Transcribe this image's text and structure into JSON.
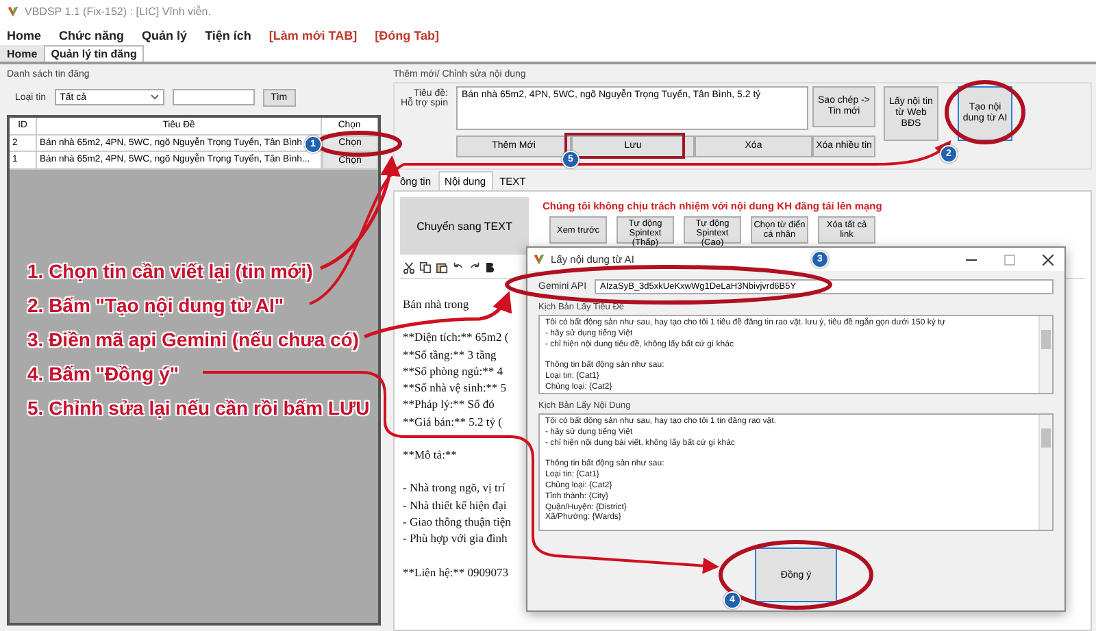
{
  "window": {
    "title": "VBDSP 1.1 (Fix-152) : [LIC] Vĩnh viễn."
  },
  "menu": [
    {
      "label": "Home",
      "kind": "menu"
    },
    {
      "label": "Chức năng",
      "kind": "menu"
    },
    {
      "label": "Quản lý",
      "kind": "menu"
    },
    {
      "label": "Tiện ích",
      "kind": "menu"
    },
    {
      "label": "[Làm mới TAB]",
      "kind": "action"
    },
    {
      "label": "[Đóng Tab]",
      "kind": "action"
    }
  ],
  "tabs": [
    {
      "label": "Home",
      "selected": false
    },
    {
      "label": "Quản lý tin đăng",
      "selected": true
    }
  ],
  "list_panel": {
    "title": "Danh sách tin đăng",
    "filter_label": "Loại tin",
    "filter_value": "Tất cả",
    "search_button": "Tìm",
    "columns": [
      "ID",
      "Tiêu Đề",
      "Chọn"
    ],
    "rows": [
      {
        "id": "2",
        "title": "Bán nhà 65m2, 4PN, 5WC, ngõ Nguyễn Trọng Tuyển, Tân Bình",
        "action": "Chọn"
      },
      {
        "id": "1",
        "title": "Bán nhà 65m2, 4PN, 5WC, ngõ Nguyễn Trọng Tuyển, Tân Bình...",
        "action": "Chọn"
      }
    ]
  },
  "edit_panel": {
    "title": "Thêm mới/ Chỉnh sửa nội dung",
    "title_label": "Tiêu đề:",
    "spin_label": "Hỗ trợ spin",
    "title_value": "Bán nhà 65m2, 4PN, 5WC, ngõ Nguyễn Trọng Tuyển, Tân Bình, 5.2 tỷ",
    "copy_button": "Sao chép -> Tin mới",
    "side_buttons": [
      {
        "label": "Lấy nội tin từ Web BĐS",
        "focused": false
      },
      {
        "label": "Tạo nội dung từ AI",
        "focused": true
      }
    ],
    "row_buttons": [
      "Thêm Mới",
      "Lưu",
      "Xóa",
      "Xóa nhiều tin"
    ]
  },
  "content_tabs": [
    {
      "label": "ông tin",
      "selected": false
    },
    {
      "label": "Nội dung",
      "selected": true
    },
    {
      "label": "TEXT",
      "selected": false
    }
  ],
  "content": {
    "convert_button": "Chuyển sang TEXT",
    "warning": "Chúng tôi không chịu trách nhiệm với nội dung KH đăng tải lên mạng",
    "tool_buttons": [
      "Xem trước",
      "Tự động Spintext (Thấp)",
      "Tự động Spintext (Cao)",
      "Chọn từ điển cá nhân",
      "Xóa tất cả link"
    ],
    "editor_paragraphs": [
      [
        "Bán nhà trong"
      ],
      [
        "**Diện tích:** 65m2 (",
        "**Số tầng:** 3 tầng",
        "**Số phòng ngủ:** 4",
        "**Số nhà vệ sinh:** 5",
        "**Pháp lý:** Sổ đỏ",
        "**Giá bán:** 5.2 tỷ ("
      ],
      [
        "**Mô tả:**"
      ],
      [
        "- Nhà trong ngõ, vị trí",
        "- Nhà thiết kế hiện đại",
        "- Giao thông thuận tiện",
        "- Phù hợp với gia đình"
      ],
      [
        "**Liên hệ:** 0909073"
      ]
    ]
  },
  "dialog": {
    "title": "Lấy nội dung từ AI",
    "api_label": "Gemini API",
    "api_value": "AIzaSyB_3d5xkUeKxwWg1DeLaH3Nbivjvrd6B5Y",
    "title_script_label": "Kịch Bản Lấy Tiêu Đề",
    "title_script": [
      [
        "Tôi có bất động sản như sau, hay tạo cho tôi 1 tiêu đề đăng tin rao vặt. lưu ý, tiêu đề ngắn gọn dưới 150 ký tự",
        "- hãy sử dụng tiếng Việt",
        "- chỉ hiện nội dung tiêu đề, không lấy bất cứ gì khác"
      ],
      [
        "Thông tin bất động sản như sau:",
        "Loại tin: {Cat1}",
        "Chủng loại: {Cat2}"
      ]
    ],
    "content_script_label": "Kịch Bản Lấy Nội Dung",
    "content_script": [
      [
        "Tôi có bất động sản như sau, hay tạo cho tôi 1 tin đăng rao vặt.",
        "- hãy sử dụng tiếng Việt",
        "- chỉ hiện nội dung bài viết, không lấy bất cứ gì khác"
      ],
      [
        "Thông tin bất động sản như sau:",
        "Loại tin: {Cat1}",
        "Chủng loại: {Cat2}",
        "Tỉnh thành: {City}",
        "Quận/Huyện: {District}",
        "Xã/Phường: {Wards}"
      ]
    ],
    "ok_button": "Đồng ý"
  },
  "annotations": {
    "steps": [
      "1. Chọn tin cần viết lại (tin mới)",
      "2. Bấm \"Tạo nội dung từ AI\"",
      "3. Điền mã api Gemini (nếu chưa có)",
      "4. Bấm \"Đồng ý\"",
      "5. Chỉnh sửa lại nếu cần rồi bấm LƯU"
    ],
    "badges": [
      "1",
      "2",
      "3",
      "4",
      "5"
    ]
  }
}
